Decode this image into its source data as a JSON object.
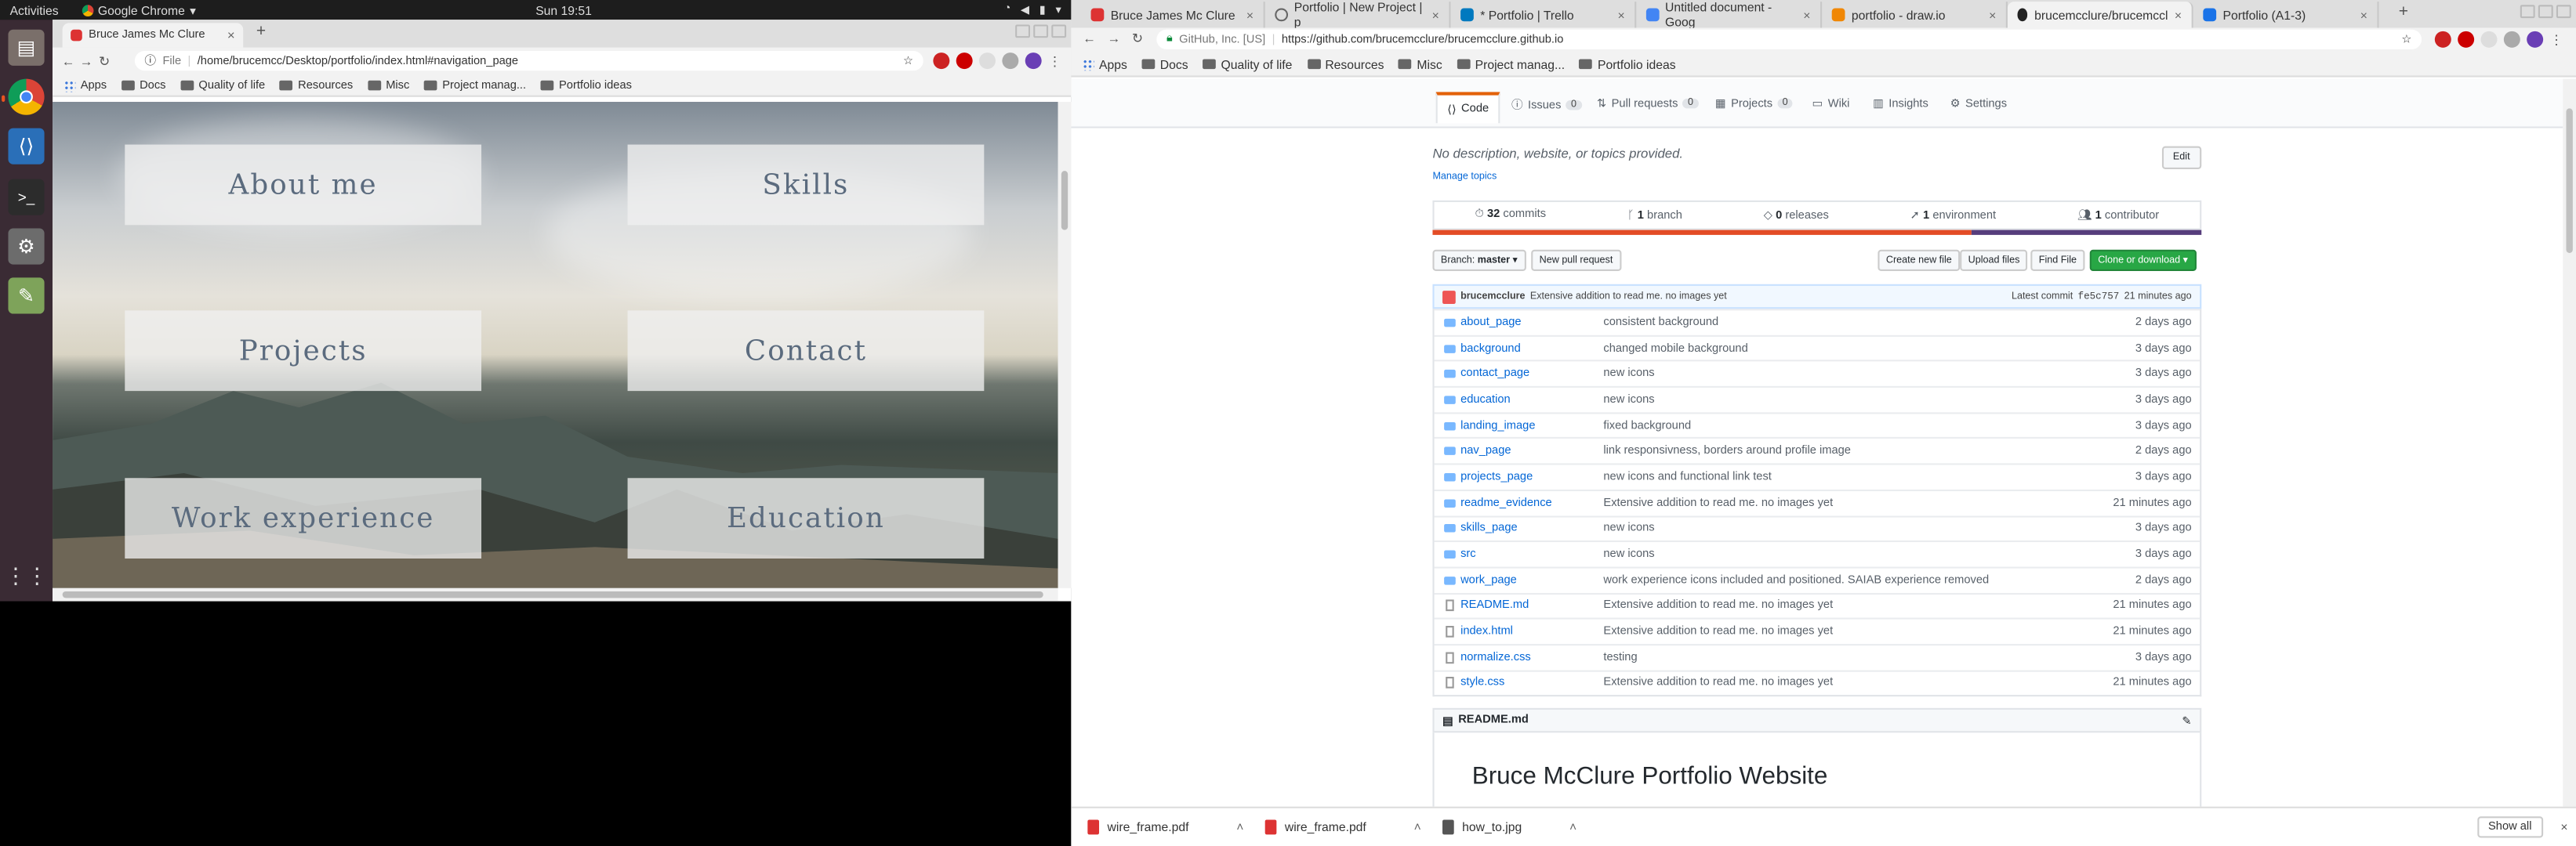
{
  "topbar": {
    "activities": "Activities",
    "app_name": "Google Chrome",
    "clock": "Sun 19:51"
  },
  "left_browser": {
    "tab_title": "Bruce James Mc Clure",
    "address_scheme": "File",
    "address_url": "/home/brucemcc/Desktop/portfolio/index.html#navigation_page",
    "bookmarks": [
      "Apps",
      "Docs",
      "Quality of life",
      "Resources",
      "Misc",
      "Project manag...",
      "Portfolio ideas"
    ],
    "nav_tiles": [
      "About me",
      "Skills",
      "Projects",
      "Contact",
      "Work experience",
      "Education"
    ]
  },
  "right_browser": {
    "tabs": [
      "Bruce James Mc Clure",
      "Portfolio | New Project | p",
      "* Portfolio | Trello",
      "Untitled document - Goog",
      "portfolio - draw.io",
      "brucemcclure/brucemccl",
      "Portfolio (A1-3)"
    ],
    "site_identity": "GitHub, Inc. [US]",
    "address_url": "https://github.com/brucemcclure/brucemcclure.github.io",
    "bookmarks": [
      "Apps",
      "Docs",
      "Quality of life",
      "Resources",
      "Misc",
      "Project manag...",
      "Portfolio ideas"
    ],
    "repo_tabs": [
      {
        "label": "Code",
        "count": ""
      },
      {
        "label": "Issues",
        "count": "0"
      },
      {
        "label": "Pull requests",
        "count": "0"
      },
      {
        "label": "Projects",
        "count": "0"
      },
      {
        "label": "Wiki",
        "count": ""
      },
      {
        "label": "Insights",
        "count": ""
      },
      {
        "label": "Settings",
        "count": ""
      }
    ],
    "description": "No description, website, or topics provided.",
    "manage_topics": "Manage topics",
    "edit_label": "Edit",
    "summary": {
      "commits_count": "32",
      "commits_label": "commits",
      "branch_count": "1",
      "branch_label": "branch",
      "releases_count": "0",
      "releases_label": "releases",
      "env_count": "1",
      "env_label": "environment",
      "contrib_count": "1",
      "contrib_label": "contributor"
    },
    "lang_colors": [
      "#e34c26",
      "#563d7c"
    ],
    "branch_label": "Branch:",
    "branch_value": "master",
    "new_pr": "New pull request",
    "create_file": "Create new file",
    "upload_files": "Upload files",
    "find_file": "Find File",
    "clone": "Clone or download",
    "latest_commit": {
      "author": "brucemcclure",
      "message": "Extensive addition to read me. no images yet",
      "prefix": "Latest commit",
      "sha": "fe5c757",
      "age": "21 minutes ago"
    },
    "files": [
      {
        "name": "about_page",
        "type": "dir",
        "message": "consistent background",
        "age": "2 days ago"
      },
      {
        "name": "background",
        "type": "dir",
        "message": "changed mobile background",
        "age": "3 days ago"
      },
      {
        "name": "contact_page",
        "type": "dir",
        "message": "new icons",
        "age": "3 days ago"
      },
      {
        "name": "education",
        "type": "dir",
        "message": "new icons",
        "age": "3 days ago"
      },
      {
        "name": "landing_image",
        "type": "dir",
        "message": "fixed background",
        "age": "3 days ago"
      },
      {
        "name": "nav_page",
        "type": "dir",
        "message": "link responsivness, borders around profile image",
        "age": "2 days ago"
      },
      {
        "name": "projects_page",
        "type": "dir",
        "message": "new icons and functional link test",
        "age": "3 days ago"
      },
      {
        "name": "readme_evidence",
        "type": "dir",
        "message": "Extensive addition to read me. no images yet",
        "age": "21 minutes ago"
      },
      {
        "name": "skills_page",
        "type": "dir",
        "message": "new icons",
        "age": "3 days ago"
      },
      {
        "name": "src",
        "type": "dir",
        "message": "new icons",
        "age": "3 days ago"
      },
      {
        "name": "work_page",
        "type": "dir",
        "message": "work experience icons included and positioned. SAIAB experience removed",
        "age": "2 days ago"
      },
      {
        "name": "README.md",
        "type": "file",
        "message": "Extensive addition to read me. no images yet",
        "age": "21 minutes ago"
      },
      {
        "name": "index.html",
        "type": "file",
        "message": "Extensive addition to read me. no images yet",
        "age": "21 minutes ago"
      },
      {
        "name": "normalize.css",
        "type": "file",
        "message": "testing",
        "age": "3 days ago"
      },
      {
        "name": "style.css",
        "type": "file",
        "message": "Extensive addition to read me. no images yet",
        "age": "21 minutes ago"
      }
    ],
    "readme_header": "README.md",
    "readme_title": "Bruce McClure Portfolio Website"
  },
  "downloads": {
    "items": [
      "wire_frame.pdf",
      "wire_frame.pdf",
      "how_to.jpg"
    ],
    "show_all": "Show all"
  }
}
